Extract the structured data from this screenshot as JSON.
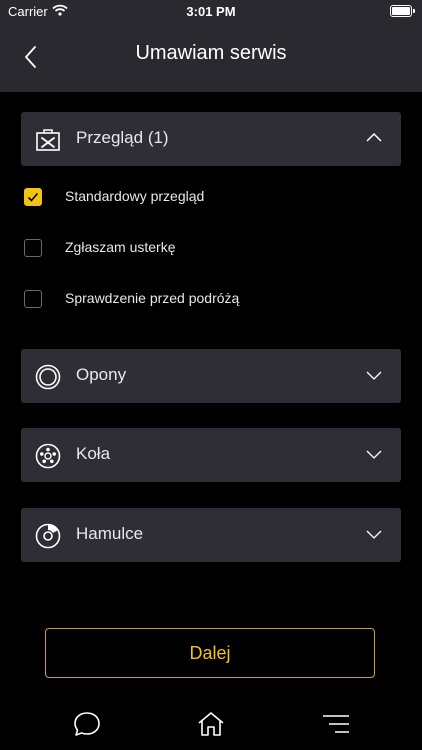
{
  "status_bar": {
    "carrier": "Carrier",
    "time": "3:01 PM"
  },
  "nav": {
    "title": "Umawiam serwis"
  },
  "sections": [
    {
      "label": "Przegląd (1)",
      "icon": "toolbox-icon",
      "expanded": true
    },
    {
      "label": "Opony",
      "icon": "tire-icon",
      "expanded": false
    },
    {
      "label": "Koła",
      "icon": "wheel-icon",
      "expanded": false
    },
    {
      "label": "Hamulce",
      "icon": "brake-disc-icon",
      "expanded": false
    }
  ],
  "options": [
    {
      "label": "Standardowy przegląd",
      "checked": true
    },
    {
      "label": "Zgłaszam usterkę",
      "checked": false
    },
    {
      "label": "Sprawdzenie przed podróżą",
      "checked": false
    }
  ],
  "cta": {
    "label": "Dalej"
  },
  "colors": {
    "accent": "#f2c311",
    "panel": "#2f2d35",
    "bar": "#2b2930",
    "background": "#000000"
  },
  "tab_bar": {
    "icons": [
      "chat-icon",
      "home-icon",
      "menu-icon"
    ]
  }
}
